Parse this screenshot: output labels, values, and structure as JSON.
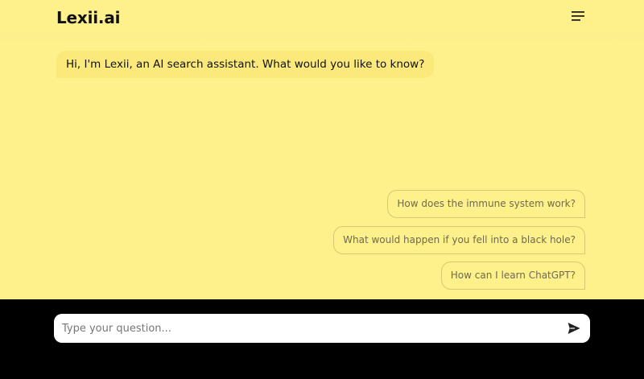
{
  "header": {
    "brand": "Lexii.ai",
    "menu_icon": "hamburger-menu-icon"
  },
  "chat": {
    "greeting": "Hi, I'm Lexii, an AI search assistant. What would you like to know?"
  },
  "suggestions": [
    "How does the immune system work?",
    "What would happen if you fell into a black hole?",
    "How can I learn ChatGPT?"
  ],
  "composer": {
    "placeholder": "Type your question...",
    "value": "",
    "send_icon": "send-icon"
  },
  "colors": {
    "background": "#fef08a",
    "greeting_bubble": "#fbe97b",
    "composer_bar": "#000000",
    "text": "#111111"
  }
}
